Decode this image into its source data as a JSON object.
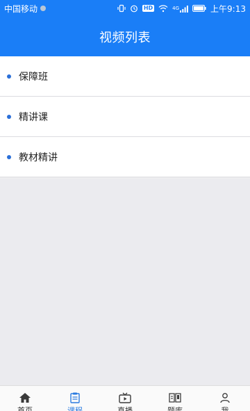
{
  "status_bar": {
    "carrier": "中国移动",
    "time": "上午9:13",
    "hd_badge": "HD",
    "network": "4G",
    "icons": [
      "vibrate-icon",
      "alarm-icon",
      "hd-icon",
      "wifi-icon",
      "signal-icon",
      "battery-icon"
    ]
  },
  "header": {
    "title": "视频列表"
  },
  "list": {
    "items": [
      {
        "label": "保障班"
      },
      {
        "label": "精讲课"
      },
      {
        "label": "教材精讲"
      }
    ]
  },
  "tabbar": {
    "active_index": 1,
    "tabs": [
      {
        "label": "首页",
        "icon": "home-icon"
      },
      {
        "label": "课程",
        "icon": "course-icon"
      },
      {
        "label": "直播",
        "icon": "live-tv-icon"
      },
      {
        "label": "题库",
        "icon": "question-bank-icon"
      },
      {
        "label": "我",
        "icon": "profile-icon"
      }
    ]
  },
  "colors": {
    "primary": "#1a7ef7",
    "bullet": "#2a6fd8",
    "background": "#ebebef",
    "active_tab": "#2a7be0"
  }
}
